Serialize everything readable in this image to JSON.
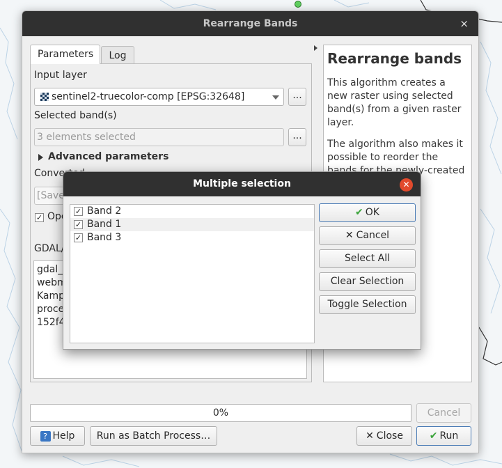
{
  "main_dialog": {
    "title": "Rearrange Bands",
    "close_glyph": "×",
    "tabs": [
      {
        "label": "Parameters",
        "active": true
      },
      {
        "label": "Log",
        "active": false
      }
    ],
    "input_layer": {
      "label": "Input layer",
      "value": "sentinel2-truecolor-comp [EPSG:32648]",
      "browse_label": "..."
    },
    "selected_bands": {
      "label": "Selected band(s)",
      "value": "3 elements selected",
      "browse_label": "..."
    },
    "advanced_parameters": {
      "label": "Advanced parameters"
    },
    "converted": {
      "label_partial": "Converted",
      "field_partial": "[Save"
    },
    "open_checkbox": {
      "label_partial": "Ope",
      "checked": true
    },
    "gdal_section": {
      "label_partial": "GDAL/",
      "console_lines": [
        "gdal_t",
        "webm",
        "Kamp",
        "proce",
        "152f4b"
      ]
    },
    "help": {
      "title": "Rearrange bands",
      "paragraphs": [
        "This algorithm creates a new raster using selected band(s) from a given raster layer.",
        "The algorithm also makes it possible to reorder the bands for the newly-created raster."
      ]
    },
    "progress": {
      "text": "0%",
      "value": 0
    },
    "buttons": {
      "cancel": "Cancel",
      "help": "Help",
      "batch": "Run as Batch Process…",
      "close": "Close",
      "run": "Run"
    }
  },
  "modal": {
    "title": "Multiple selection",
    "bands": [
      {
        "label": "Band 2",
        "checked": true
      },
      {
        "label": "Band 1",
        "checked": true
      },
      {
        "label": "Band 3",
        "checked": true
      }
    ],
    "buttons": {
      "ok": "OK",
      "cancel": "Cancel",
      "select_all": "Select All",
      "clear_selection": "Clear Selection",
      "toggle_selection": "Toggle Selection"
    }
  },
  "colors": {
    "titlebar": "#303030",
    "accent_blue": "#4a7bb5",
    "close_red": "#e24a2c",
    "check_green": "#3aa33a"
  }
}
